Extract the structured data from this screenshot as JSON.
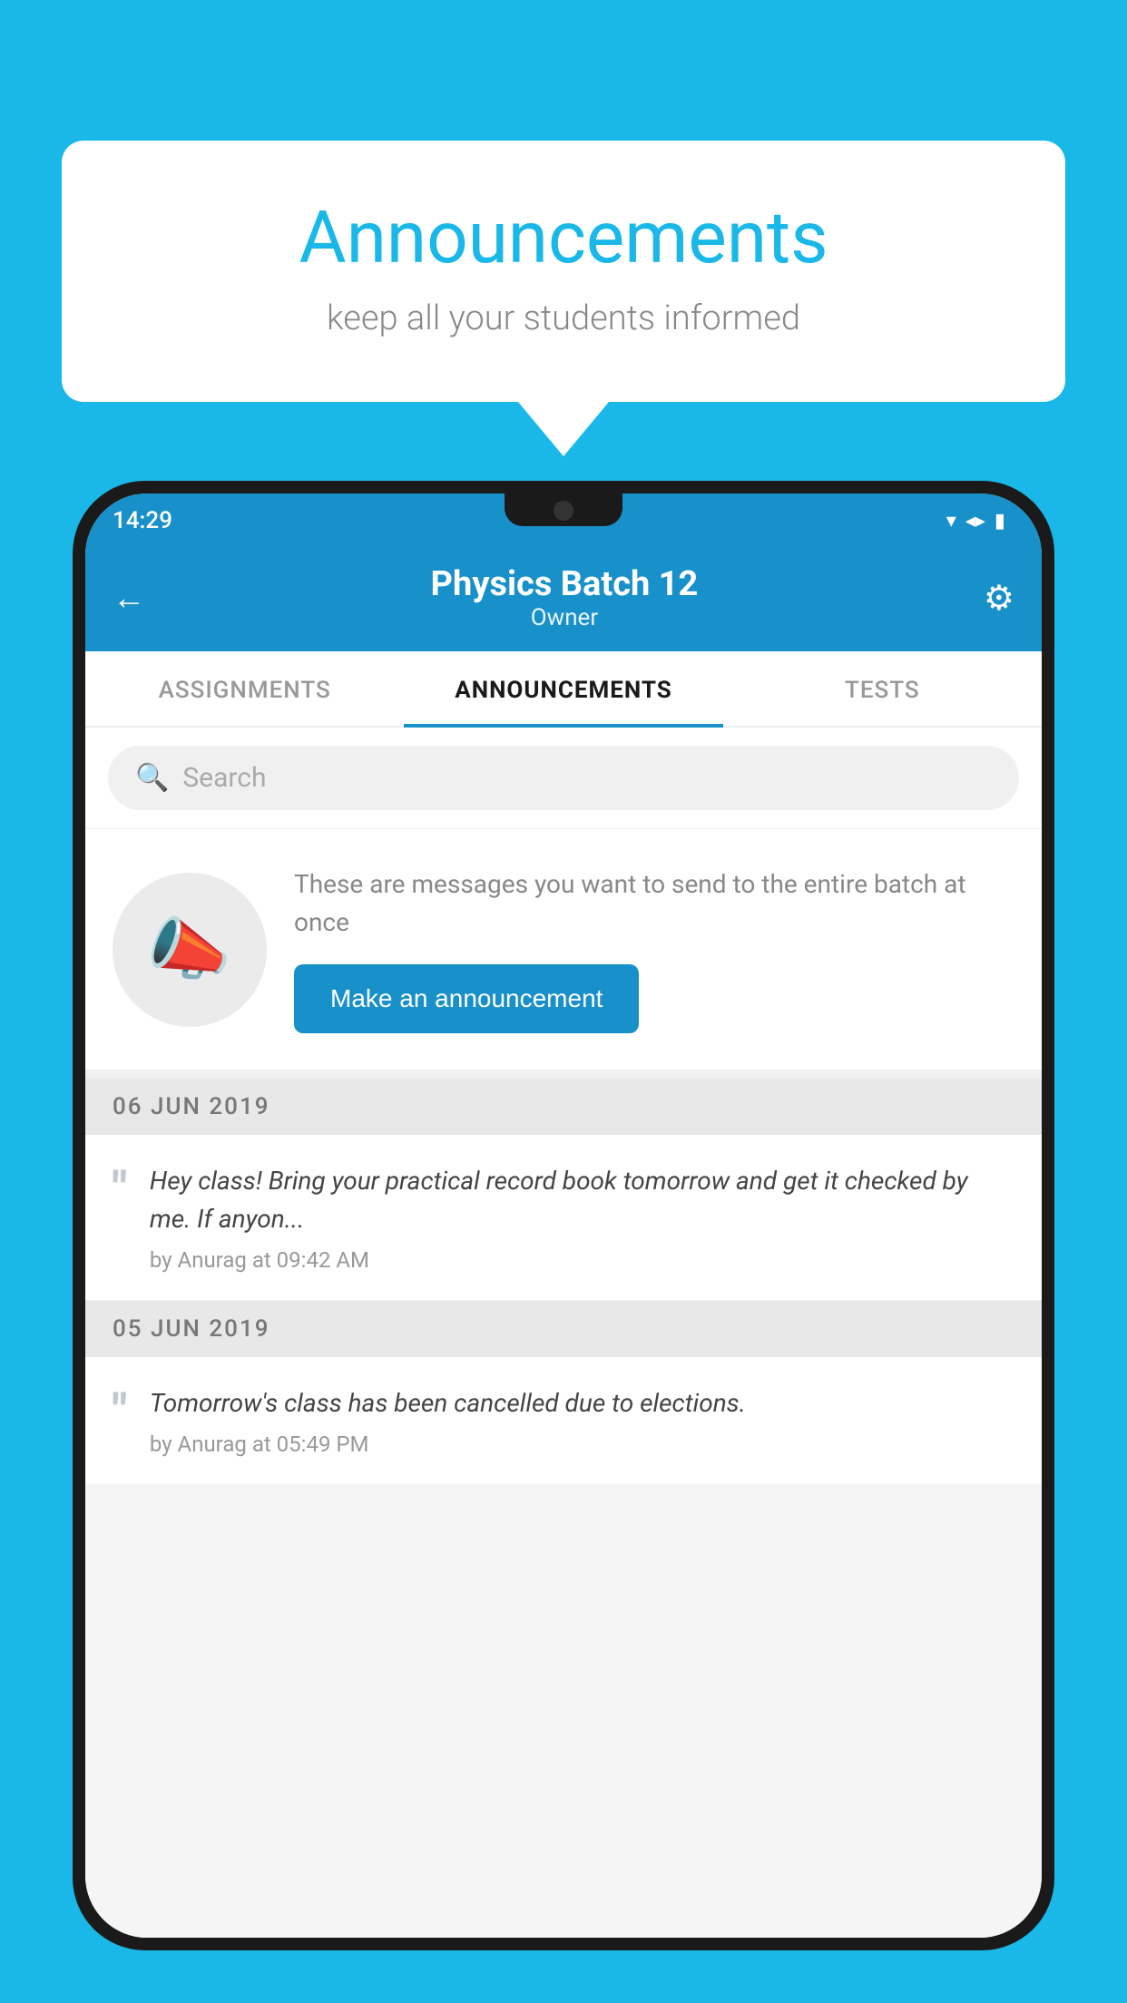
{
  "page": {
    "background_color": "#1ab8e8"
  },
  "speech_bubble": {
    "title": "Announcements",
    "subtitle": "keep all your students informed",
    "title_color": "#1ab8e8"
  },
  "status_bar": {
    "time": "14:29",
    "wifi": "▼",
    "signal": "▲",
    "battery": "▮"
  },
  "header": {
    "title": "Physics Batch 12",
    "subtitle": "Owner",
    "back_label": "←",
    "gear_label": "⚙"
  },
  "tabs": [
    {
      "id": "assignments",
      "label": "ASSIGNMENTS",
      "active": false
    },
    {
      "id": "announcements",
      "label": "ANNOUNCEMENTS",
      "active": true
    },
    {
      "id": "tests",
      "label": "TESTS",
      "active": false
    }
  ],
  "search": {
    "placeholder": "Search"
  },
  "announcement_prompt": {
    "description": "These are messages you want to send to the entire batch at once",
    "button_label": "Make an announcement"
  },
  "dates": [
    {
      "label": "06  JUN  2019",
      "messages": [
        {
          "text": "Hey class! Bring your practical record book tomorrow and get it checked by me. If anyon...",
          "author": "by Anurag at 09:42 AM"
        }
      ]
    },
    {
      "label": "05  JUN  2019",
      "messages": [
        {
          "text": "Tomorrow's class has been cancelled due to elections.",
          "author": "by Anurag at 05:49 PM"
        }
      ]
    }
  ]
}
